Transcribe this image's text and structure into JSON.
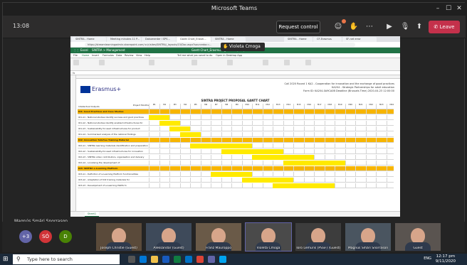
{
  "window": {
    "title": "Microsoft Teams"
  },
  "meeting": {
    "timer": "13:08",
    "request_control_label": "Request control",
    "leave_label": "Leave",
    "presenter": "Violeta Cmoga",
    "sharer_name": "Magnús Smári Snorrason",
    "accent": "#6264a7",
    "leave_color": "#c4314b"
  },
  "shared": {
    "browser_tabs": [
      "SINTRA - Home",
      "Meeting minutes 11 P...",
      "Dokumenter i SPS...",
      "Gantt Chart_Erasm...",
      "SINTRA - Home",
      "SINTRA - Home",
      "CF-Erasmus",
      "SF-net error"
    ],
    "url": "https://streamlearningadmin.sharepoint.com/:x:/r/sites/SINTRA/_layouts/15/Doc.aspx?sourcedoc=...",
    "excel_app": "Excel",
    "excel_path": "SINTRA > Management",
    "doc_title": "Gantt Chart_Erasmus+_SINTRA (002)",
    "doc_status": "Saved",
    "menu": [
      "File",
      "Home",
      "Insert",
      "Formulas",
      "Data",
      "Review",
      "View",
      "Help"
    ],
    "tell_me": "Tell me what you want to do",
    "open_desktop": "Open in Desktop App",
    "logo_text": "Erasmus+",
    "info_lines": [
      "Call 2020 Round 1 KA2 - Cooperation for innovation and the exchange of good practices",
      "KA204 - Strategic Partnerships for adult education",
      "Form ID: KA204-0A9CA0B Deadline (Brussels Time) 2020-04-23 12:00:00"
    ],
    "gantt_title": "SINTRA PROJECT PROPOSAL GANTT CHART",
    "month_header": "Project Months",
    "months": [
      "M1",
      "M2",
      "M3",
      "M4",
      "M5",
      "M6",
      "M7",
      "M8",
      "M9",
      "M10",
      "M11",
      "M12",
      "M13",
      "M14",
      "M15",
      "M16",
      "M17",
      "M18",
      "M19",
      "M20",
      "M21",
      "M22",
      "M23",
      "M24"
    ],
    "row_header": "Intellectual Outputs",
    "rows": [
      {
        "label": "IO1: Good Practices and Case Studies",
        "section": true,
        "start": 0,
        "span": 24
      },
      {
        "label": "IO1.A1 - National studies identify success and good practices",
        "start": 0,
        "span": 2
      },
      {
        "label": "IO1.A2 - National studies identify enabled infrastructures for",
        "start": 1,
        "span": 2
      },
      {
        "label": "IO1.A3 - Sustainability focused infrastructures for product",
        "start": 2,
        "span": 2
      },
      {
        "label": "IO1.A4 - Summarised analysis of the national findings",
        "start": 3,
        "span": 2
      },
      {
        "label": "IO2: Innovation Toll-free Training Material",
        "section": true,
        "start": 4,
        "span": 20
      },
      {
        "label": "IO2.A1 - SINTRA learning materials identification and preparation",
        "start": 4,
        "span": 6
      },
      {
        "label": "IO2.A2 - Sustainability-focused infrastructures for innovation",
        "start": 7,
        "span": 6
      },
      {
        "label": "IO2.A3 - SINTRA video contributors, organisation and delivery",
        "start": 10,
        "span": 6
      },
      {
        "label": "IO2.A4 - Localising the development of",
        "start": 13,
        "span": 6
      },
      {
        "label": "IO3: SINTRA e-Learning Platform",
        "section": true,
        "start": 6,
        "span": 18
      },
      {
        "label": "IO3.A1 - Definition of e-Learning Platform functionalities",
        "start": 6,
        "span": 4
      },
      {
        "label": "IO3.A2 - Adaptation of IO2 training materials for",
        "start": 9,
        "span": 5
      },
      {
        "label": "IO3.A3 - Development of e-Learning Platform",
        "start": 12,
        "span": 6
      }
    ],
    "sheet_tab": "Sheet1"
  },
  "participants": {
    "avatars": [
      {
        "initials": "+3",
        "color": "#6264a7"
      },
      {
        "initials": "SÓ",
        "color": "#d13438"
      },
      {
        "initials": "D",
        "color": "#498205"
      }
    ],
    "tiles": [
      {
        "name": "Joseph Christie (Guest)"
      },
      {
        "name": "Aleksandar (Guest)"
      },
      {
        "name": "Franz Mauroppo"
      },
      {
        "name": "Violeta Cmoga",
        "active": true
      },
      {
        "name": "Toro Lemuris (PSSF) (Guest)"
      },
      {
        "name": "Magnús Smári Snorrason"
      },
      {
        "name": "Guest"
      }
    ]
  },
  "taskbar": {
    "search_placeholder": "Type here to search",
    "lang": "ENG",
    "time": "12:17 pm",
    "date": "9/11/2020"
  }
}
